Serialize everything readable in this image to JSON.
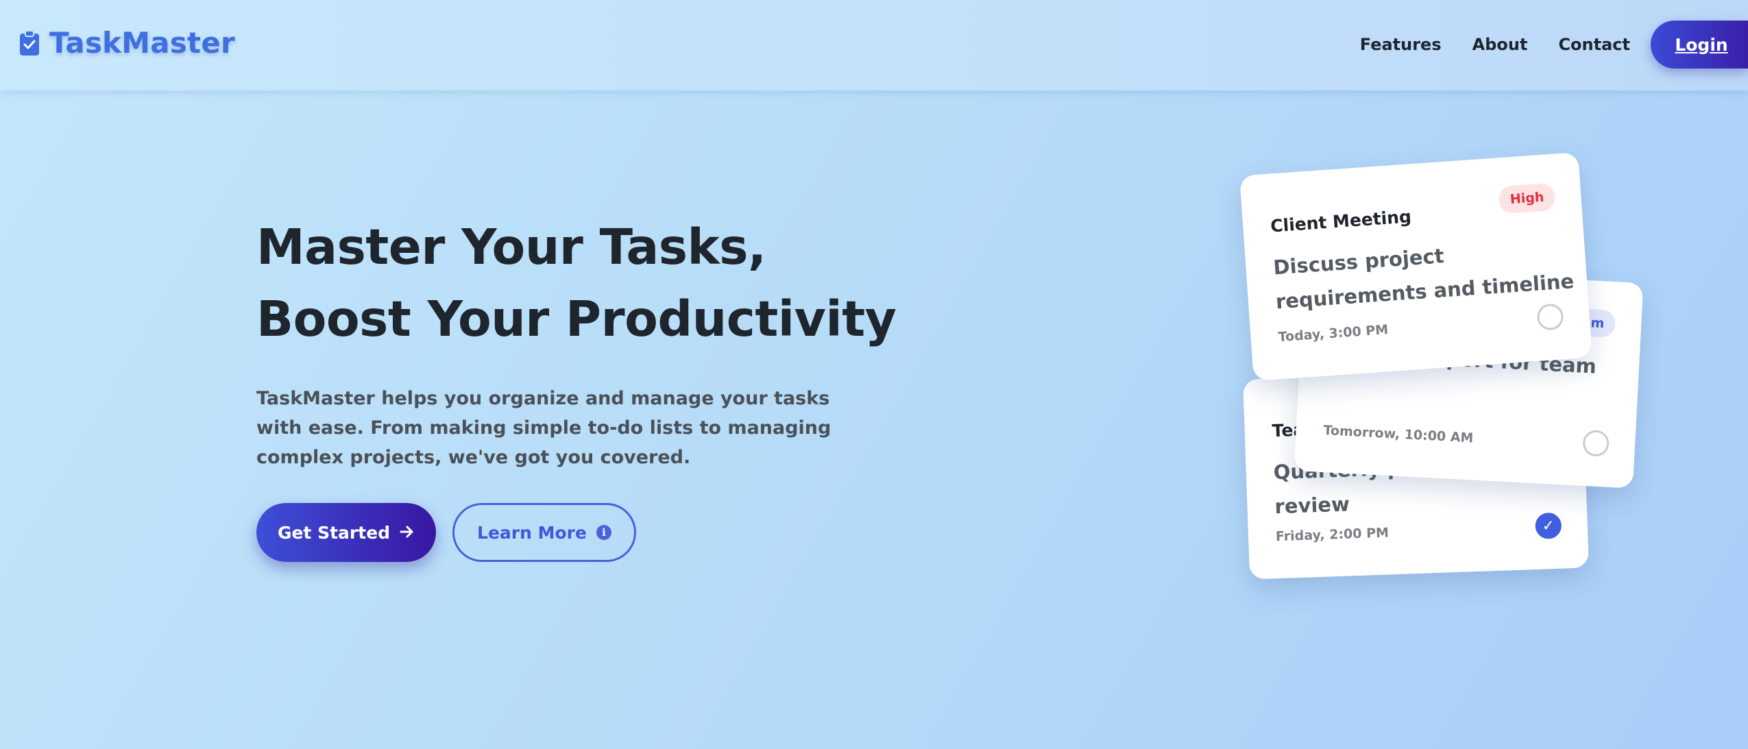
{
  "brand": {
    "name": "TaskMaster",
    "icon": "clipboard-check-icon",
    "color": "#3f6fe0"
  },
  "nav": {
    "links": [
      "Features",
      "About",
      "Contact"
    ],
    "login_label": "Login"
  },
  "hero": {
    "title_line1": "Master Your Tasks,",
    "title_line2": "Boost Your Productivity",
    "description": "TaskMaster helps you organize and manage your tasks with ease. From making simple to-do lists to managing complex projects, we've got you covered.",
    "primary_button": {
      "label": "Get Started",
      "icon": "arrow-right-icon"
    },
    "secondary_button": {
      "label": "Learn More",
      "icon": "info-icon"
    }
  },
  "cards": [
    {
      "title": "Client Meeting",
      "priority": "High",
      "body": "Discuss project requirements and timeline",
      "date": "Today, 3:00 PM",
      "completed": false
    },
    {
      "title": "",
      "priority": "Medium",
      "body": "Prepare report for team",
      "date": "Tomorrow, 10:00 AM",
      "completed": false
    },
    {
      "title": "Team Review",
      "priority": "",
      "body": "Quarterly performance review",
      "date": "Friday, 2:00 PM",
      "completed": true
    }
  ],
  "colors": {
    "accent": "#3f5ee0",
    "button_gradient_start": "#3e4fd8",
    "button_gradient_end": "#3816a2",
    "high_priority": "#e0303e",
    "medium_priority": "#3e5ad8"
  }
}
